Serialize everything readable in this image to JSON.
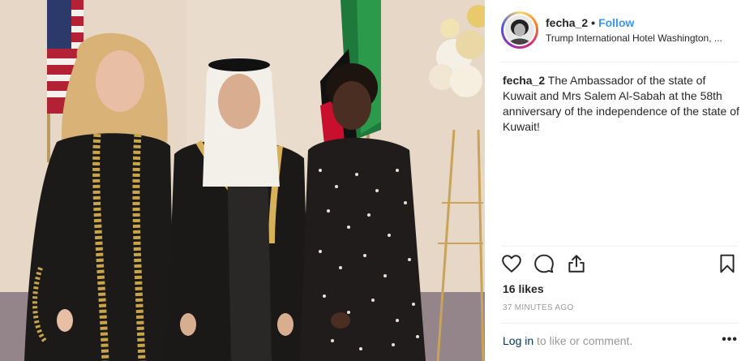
{
  "post": {
    "image_alt": "Three people posing in front of US and Kuwait flags"
  },
  "header": {
    "username": "fecha_2",
    "separator": "•",
    "follow_label": "Follow",
    "location": "Trump International Hotel Washington, ..."
  },
  "caption": {
    "username": "fecha_2",
    "text": "The Ambassador of the state of Kuwait and Mrs Salem Al-Sabah at the 58th anniversary of the independence of the state of Kuwait!"
  },
  "actions": {
    "icons": [
      "heart-icon",
      "comment-icon",
      "share-icon",
      "bookmark-icon"
    ]
  },
  "stats": {
    "likes": "16 likes",
    "timestamp": "37 MINUTES AGO"
  },
  "footer": {
    "login_label": "Log in",
    "login_suffix": " to like or comment.",
    "more_label": "•••"
  },
  "colors": {
    "accent": "#3897f0",
    "link_dark": "#003569",
    "muted": "#999999",
    "text": "#262626"
  }
}
